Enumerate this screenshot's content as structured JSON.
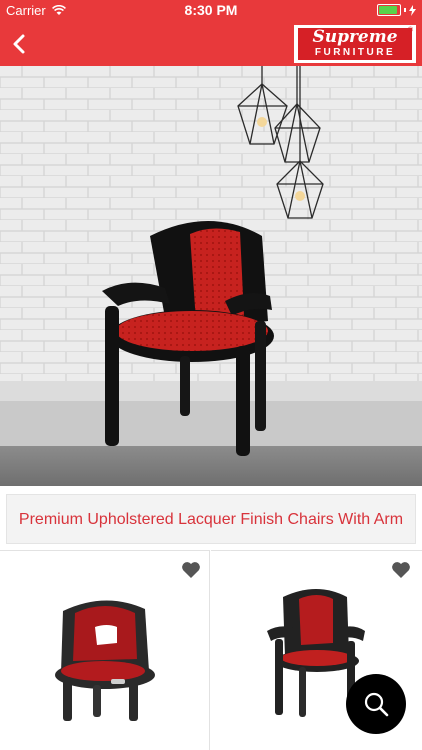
{
  "status_bar": {
    "carrier": "Carrier",
    "time": "8:30 PM",
    "battery_level": 0.9,
    "battery_color": "#5ad34a"
  },
  "navbar": {
    "background": "#e8393b",
    "back_icon": "chevron-left-icon",
    "logo": {
      "brand": "Supreme",
      "subtitle": "FURNITURE",
      "reg_mark": "®"
    }
  },
  "product": {
    "title": "Premium Upholstered Lacquer Finish Chairs With Arm"
  },
  "grid": {
    "items": [
      {
        "favorite_icon": "heart-icon"
      },
      {
        "favorite_icon": "heart-icon"
      }
    ]
  },
  "fab": {
    "icon": "search-icon"
  },
  "colors": {
    "accent": "#e8393b",
    "title_text": "#d8333b",
    "heart": "#555555"
  }
}
